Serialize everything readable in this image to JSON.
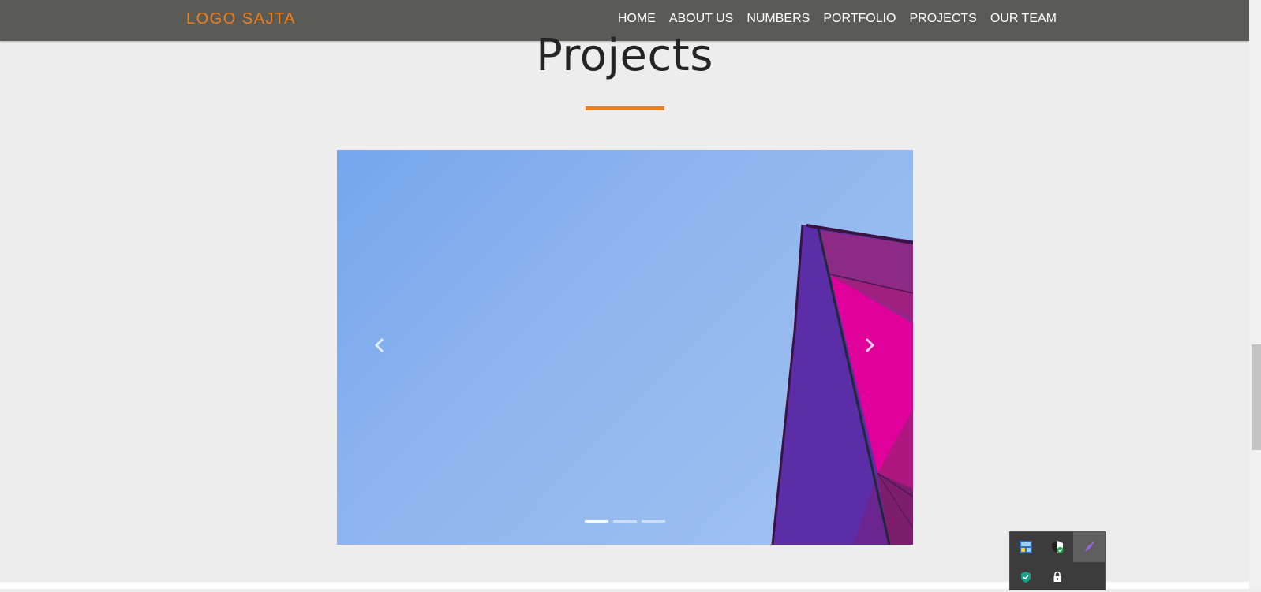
{
  "navbar": {
    "logo": "LOGO SAJTA",
    "links": [
      "HOME",
      "ABOUT US",
      "NUMBERS",
      "PORTFOLIO",
      "PROJECTS",
      "OUR TEAM"
    ]
  },
  "section": {
    "title": "Projects"
  },
  "carousel": {
    "slide_count": 3,
    "active_slide": 1,
    "image_subject": "magenta-glass-building-blue-sky"
  },
  "tray": {
    "icons": [
      "network-manager-icon",
      "shield-check-icon",
      "feather-icon",
      "security-check-icon",
      "lock-network-icon"
    ]
  },
  "colors": {
    "accent": "#ef7f1a",
    "navbar": "#5a5a56",
    "background": "#ededed",
    "title": "#222426"
  }
}
